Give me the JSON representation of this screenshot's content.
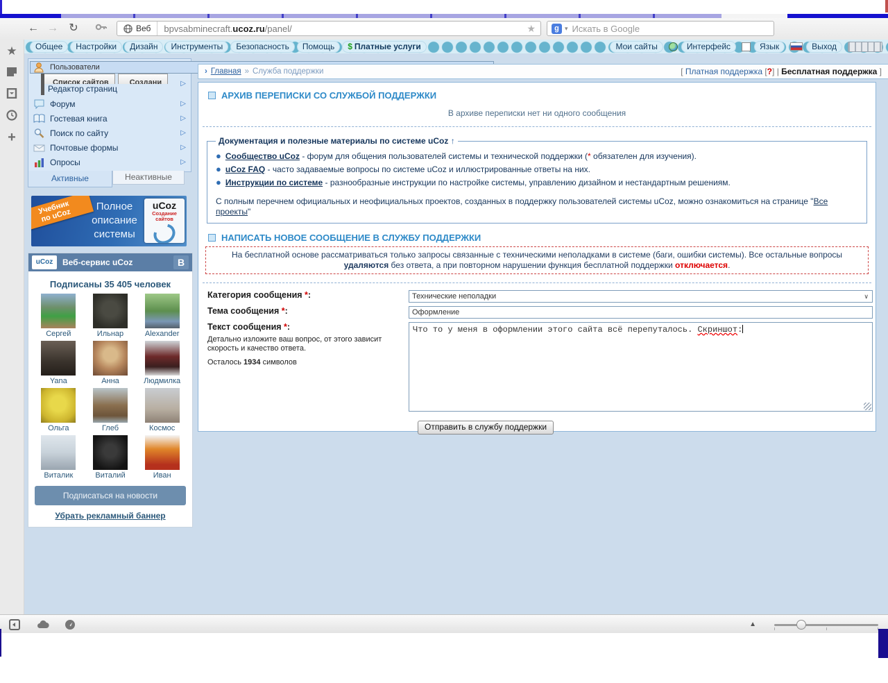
{
  "icons": {
    "back": "←",
    "forward": "→",
    "reload": "↻",
    "bookmark_star": "★",
    "caret_down": "▾",
    "rail_star": "★",
    "rail_plus": "+",
    "chevron_right": "▷",
    "breadcrumb_arrow": "›",
    "legend_up": "↑",
    "select_chevron": "∨",
    "zoom_triangle": "▲",
    "google": "g",
    "dollar": "$"
  },
  "browser": {
    "badge": "Веб",
    "url": {
      "prefix": "bpvsabminecraft.",
      "bold": "ucoz.ru",
      "suffix": "/panel/"
    },
    "search_placeholder": "Искать в Google"
  },
  "top_menu": {
    "items": [
      "Общее",
      "Настройки",
      "Дизайн",
      "Инструменты",
      "Безопасность",
      "Помощь"
    ],
    "paid": "Платные услуги",
    "my_sites": "Мои сайты",
    "interface": "Интерфейс",
    "language": "Язык",
    "logout": "Выход"
  },
  "sidebar": {
    "menu": [
      "Пользователи",
      "Редактор страниц",
      "Форум",
      "Гостевая книга",
      "Поиск по сайту",
      "Почтовые формы",
      "Опросы"
    ],
    "glitch": {
      "left": "Список сайтов",
      "right": "Создани"
    },
    "tabs": {
      "active": "Активные",
      "inactive": "Неактивные"
    },
    "banner": {
      "ribbon_l1": "Учебник",
      "ribbon_l2": "по uCoz",
      "line1": "Полное",
      "line2": "описание",
      "line3": "системы",
      "book_title": "uCoz",
      "book_sub": "Создание сайтов"
    },
    "vk": {
      "logo": "uCoz",
      "header": "Веб-сервис uCoz",
      "letter": "В",
      "subscribers": "Подписаны 35 405 человек",
      "people": [
        {
          "name": "Сергей",
          "bg": "linear-gradient(180deg,#8fb0cf 0%,#6d8f6a 40%,#3fa045 65%,#a9825d 100%)"
        },
        {
          "name": "Ильнар",
          "bg": "radial-gradient(circle at 50% 45%,#4a4a42 30%,#2e2e28 75%)"
        },
        {
          "name": "Alexander",
          "bg": "linear-gradient(180deg,#9ec887 0%,#5d8f4e 50%,#7a97b5 80%,#55606a 100%)"
        },
        {
          "name": "Yana",
          "bg": "linear-gradient(180deg,#6a5f55 0%,#3a332c 60%,#241f1a 100%)"
        },
        {
          "name": "Анна",
          "bg": "radial-gradient(circle at 50% 40%,#d9b98a 25%,#b5855c 55%,#6e4a33 100%)"
        },
        {
          "name": "Людмилка",
          "bg": "linear-gradient(180deg,#cfd4d8 0%,#6e2a2a 45%,#3a1f1f 75%,#d8d8d8 100%)"
        },
        {
          "name": "Ольга",
          "bg": "radial-gradient(circle at 50% 45%,#e8d84a 30%,#cdb52e 70%,#8f7d1e 100%)"
        },
        {
          "name": "Глеб",
          "bg": "linear-gradient(180deg,#b9c4c9 0%,#8a6f4f 50%,#6d553a 80%,#99a6ad 100%)"
        },
        {
          "name": "Космос",
          "bg": "linear-gradient(180deg,#c9cdd1 0%,#b8afa2 60%,#8f8276 100%)"
        },
        {
          "name": "Виталик",
          "bg": "linear-gradient(180deg,#dfe6ec 0%,#c8d2da 50%,#9aa5b0 100%)"
        },
        {
          "name": "Виталий",
          "bg": "radial-gradient(circle at 50% 45%,#3a3a3a 25%,#141414 75%)"
        },
        {
          "name": "Иван",
          "bg": "linear-gradient(180deg,#f5f5f5 0%,#e0862a 40%,#b5301d 85%)"
        }
      ],
      "subscribe": "Подписаться на новости",
      "remove": "Убрать рекламный баннер"
    }
  },
  "main": {
    "breadcrumb": {
      "home": "Главная",
      "sep": "»",
      "current": "Служба поддержки"
    },
    "support_nav": {
      "lbracket": "[ ",
      "paid": "Платная поддержка",
      "qo": " [",
      "q": "?",
      "qc": "] ",
      "pipe": "| ",
      "free": "Бесплатная поддержка",
      "rbracket": " ]"
    },
    "archive": {
      "title": "АРХИВ ПЕРЕПИСКИ СО СЛУЖБОЙ ПОДДЕРЖКИ",
      "empty": "В архиве переписки нет ни одного сообщения"
    },
    "docs": {
      "legend": "Документация и полезные материалы по системе uCoz",
      "item1": {
        "link": "Сообщество uCoz",
        "before": " - форум для общения пользователей системы и технической поддержки (",
        "star": "*",
        "after": " обязателен для изучения)."
      },
      "item2": {
        "link": "uCoz FAQ",
        "after": " - часто задаваемые вопросы по системе uCoz и иллюстрированные ответы на них."
      },
      "item3": {
        "link": "Инструкции по системе",
        "after": " - разнообразные инструкции по настройке системы, управлению дизайном и нестандартным решениям."
      },
      "footer_before": "С полным перечнем официальных и неофициальных проектов, созданных в поддержку пользователей системы uCoz, можно ознакомиться на странице \"",
      "footer_link": "Все проекты",
      "footer_after": "\""
    },
    "compose": {
      "title": "НАПИСАТЬ НОВОЕ СООБЩЕНИЕ В СЛУЖБУ ПОДДЕРЖКИ",
      "warn1": "На бесплатной основе рассматриваться только запросы связанные с техническими неполадками в системе (баги, ошибки системы). Все остальные вопросы ",
      "warn_bold": "удаляются",
      "warn2": " без ответа, а при повторном нарушении функция бесплатной поддержки ",
      "warn_red": "отключается",
      "warn3": ".",
      "star": "*",
      "colon": ":",
      "category_label": "Категория сообщения ",
      "category_value": "Технические неполадки",
      "subject_label": "Тема сообщения ",
      "subject_value": "Оформление",
      "text_label": "Текст сообщения ",
      "hint": "Детально изложите ваш вопрос, от этого зависит скорость и качество ответа.",
      "left_label": "Осталось ",
      "left_count": "1934",
      "left_suffix": " символов",
      "message_before": "Что то у меня в оформлении этого сайта всё перепуталось. ",
      "message_word": "Скриншот",
      "message_after": ":",
      "submit": "Отправить в службу поддержки"
    }
  },
  "colors": {
    "accent_blue": "#2e8ac8",
    "panel_bg": "#ccdcec",
    "vk_blue": "#5b7ea6",
    "warning_red": "#dd0000",
    "link_navy": "#16365c"
  }
}
